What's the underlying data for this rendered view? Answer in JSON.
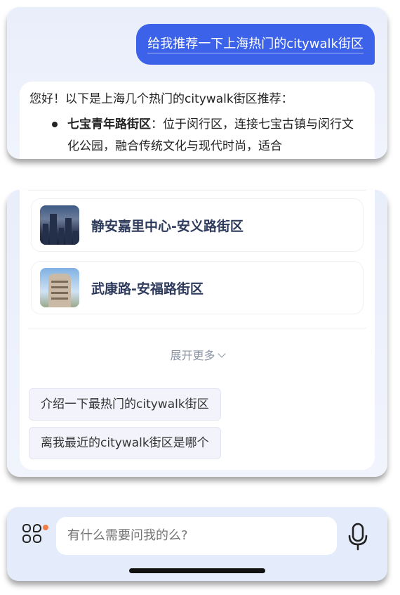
{
  "chat": {
    "user_message": "给我推荐一下上海热门的citywalk街区",
    "reply_intro": "您好！以下是上海几个热门的citywalk街区推荐：",
    "reply_items": [
      {
        "title": "七宝青年路街区",
        "text": "：位于闵行区，连接七宝古镇与闵行文化公园，融合传统文化与现代时尚，适合"
      }
    ]
  },
  "districts": [
    {
      "name": "静安嘉里中心-安义路街区",
      "image": "jingan-kerry-photo"
    },
    {
      "name": "武康路-安福路街区",
      "image": "wukang-road-photo"
    }
  ],
  "expand_more_label": "展开更多",
  "suggestions": [
    "介绍一下最热门的citywalk街区",
    "离我最近的citywalk街区是哪个"
  ],
  "input": {
    "placeholder": "有什么需要问我的么?"
  },
  "colors": {
    "accent": "#3b62e8",
    "card_bg": "#eef2fc",
    "district_title": "#2f3b5c",
    "dot_orange": "#f07c48"
  }
}
